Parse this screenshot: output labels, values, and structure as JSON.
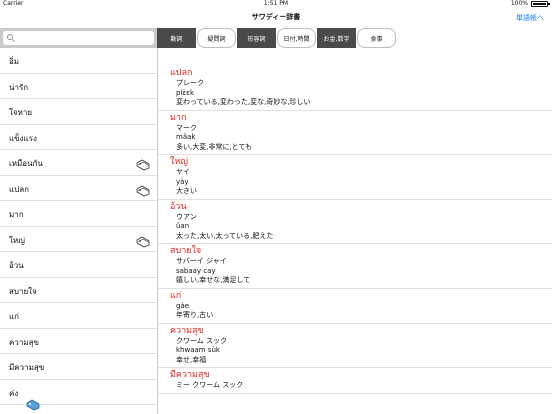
{
  "status": {
    "carrier": "Carrier",
    "time": "1:51 PM",
    "battery": "100%"
  },
  "nav": {
    "title": "サワディー辞書",
    "right_button": "単語帳へ"
  },
  "search": {
    "placeholder": ""
  },
  "tabs": [
    {
      "label": "動詞",
      "style": "dark"
    },
    {
      "label": "疑問詞",
      "style": "light"
    },
    {
      "label": "形容詞",
      "style": "dark"
    },
    {
      "label": "日付,時間",
      "style": "light"
    },
    {
      "label": "お金,数字",
      "style": "dark"
    },
    {
      "label": "食事",
      "style": "light"
    }
  ],
  "left_items": [
    {
      "word": "อิ่ม",
      "tagged": false
    },
    {
      "word": "น่ารัก",
      "tagged": false
    },
    {
      "word": "ใจหาย",
      "tagged": false
    },
    {
      "word": "แข็งแรง",
      "tagged": false
    },
    {
      "word": "เหมือนกัน",
      "tagged": true
    },
    {
      "word": "แปลก",
      "tagged": true
    },
    {
      "word": "มาก",
      "tagged": false
    },
    {
      "word": "ใหญ่",
      "tagged": true
    },
    {
      "word": "อ้วน",
      "tagged": false
    },
    {
      "word": "สบายใจ",
      "tagged": false
    },
    {
      "word": "แก่",
      "tagged": false
    },
    {
      "word": "ความสุข",
      "tagged": false
    },
    {
      "word": "มีความสุข",
      "tagged": false
    },
    {
      "word": "ค่ง",
      "tagged": false
    }
  ],
  "floating_tag_icon": "tag-icon",
  "entries": [
    {
      "thai": "แปลก",
      "kana": "プレーク",
      "roman": "plɛ̀ɛk",
      "meaning": "変わっている,変わった,変な,奇妙な,珍しい"
    },
    {
      "thai": "มาก",
      "kana": "マーク",
      "roman": "mâak",
      "meaning": "多い,大変,非常に,とても"
    },
    {
      "thai": "ใหญ่",
      "kana": "ヤイ",
      "roman": "yày",
      "meaning": "大きい"
    },
    {
      "thai": "อ้วน",
      "kana": "ウアン",
      "roman": "ûan",
      "meaning": "太った,太い,太っている,肥えた"
    },
    {
      "thai": "สบายใจ",
      "kana": "サバーイ ジャイ",
      "roman": "sabaay cay",
      "meaning": "嬉しい,幸せな,満足して"
    },
    {
      "thai": "แก่",
      "kana": "",
      "roman": "gàe",
      "meaning": "年寄り,古い"
    },
    {
      "thai": "ความสุข",
      "kana": "クワーム スック",
      "roman": "khwaam sùk",
      "meaning": "幸せ,幸福"
    },
    {
      "thai": "มีความสุข",
      "kana": "ミー クワーム スック",
      "roman": "",
      "meaning": ""
    }
  ]
}
